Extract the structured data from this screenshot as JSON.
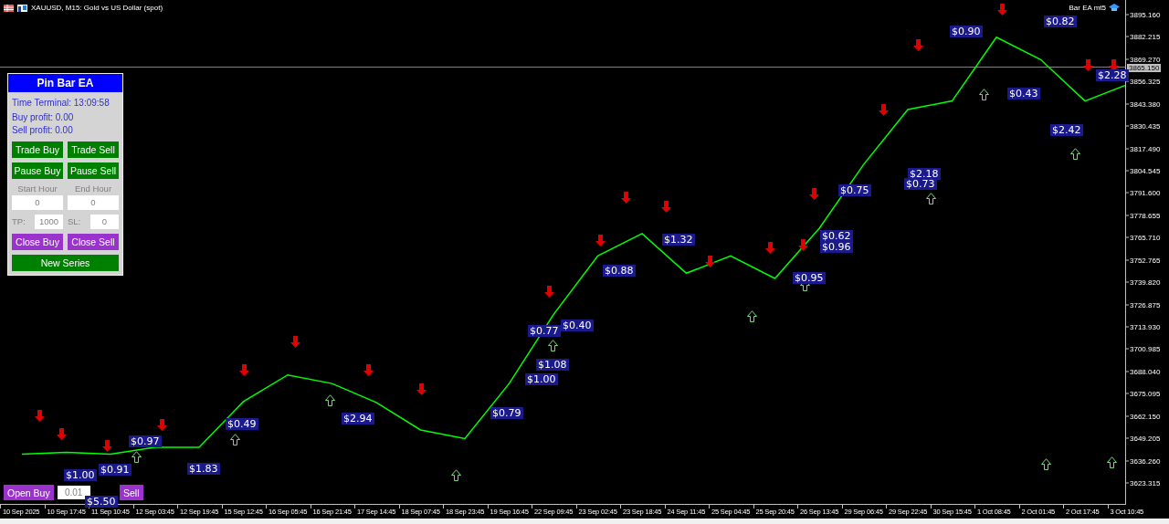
{
  "window": {
    "title": "XAUUSD, M15:  Gold vs US Dollar (spot)",
    "indicator": "Bar EA mt5"
  },
  "panel": {
    "title": "Pin Bar EA",
    "time": "Time Terminal: 13:09:58",
    "buy_profit": "Buy profit: 0.00",
    "sell_profit": "Sell profit: 0.00",
    "button_rows": [
      [
        {
          "label": "Trade Buy",
          "color": "#008000"
        },
        {
          "label": "Trade Sell",
          "color": "#008000"
        }
      ],
      [
        {
          "label": "Pause Buy",
          "color": "#008000"
        },
        {
          "label": "Pause Sell",
          "color": "#008000"
        }
      ]
    ],
    "hours": {
      "start_label": "Start Hour",
      "end_label": "End Hour",
      "start_value": "0",
      "end_value": "0"
    },
    "tp": {
      "label": "TP:",
      "value": "1000"
    },
    "sl": {
      "label": "SL:",
      "value": "0"
    },
    "close_buttons": [
      {
        "label": "Close Buy",
        "color": "#9933cc"
      },
      {
        "label": "Close Sell",
        "color": "#9933cc"
      }
    ],
    "new_series": {
      "label": "New Series",
      "color": "#008000"
    }
  },
  "order_bar": {
    "open_buy": "Open Buy",
    "lot": "0.01",
    "sell": "Sell"
  },
  "chart": {
    "current_price": "3865.150",
    "chart_data": {
      "type": "line",
      "categories": [
        "10 Sep 2025",
        "10 Sep 17:45",
        "11 Sep 10:45",
        "12 Sep 03:45",
        "12 Sep 19:45",
        "15 Sep 12:45",
        "16 Sep 05:45",
        "16 Sep 21:45",
        "17 Sep 14:45",
        "18 Sep 07:45",
        "18 Sep 23:45",
        "19 Sep 16:45",
        "22 Sep 09:45",
        "23 Sep 02:45",
        "23 Sep 18:45",
        "24 Sep 11:45",
        "25 Sep 04:45",
        "25 Sep 20:45",
        "26 Sep 13:45",
        "29 Sep 06:45",
        "29 Sep 22:45",
        "30 Sep 15:45",
        "1 Oct 08:45",
        "2 Oct 01:45",
        "2 Oct 17:45",
        "3 Oct 10:45"
      ],
      "series": [
        {
          "color": "#00ff00",
          "values": [
            3640,
            3641,
            3640,
            3644,
            3644,
            3670.5,
            3686,
            3681,
            3670,
            3654,
            3649,
            3681,
            3721,
            3755,
            3768,
            3745,
            3755,
            3742,
            3771,
            3808,
            3840,
            3845,
            3882,
            3869,
            3845,
            3855
          ]
        }
      ],
      "ylim": [
        3611.1,
        3903.6
      ],
      "yticks": [
        {
          "value": 3895.16,
          "label": "3895.160"
        },
        {
          "value": 3882.215,
          "label": "3882.215"
        },
        {
          "value": 3869.27,
          "label": "3869.270"
        },
        {
          "value": 3856.325,
          "label": "3856.325"
        },
        {
          "value": 3843.38,
          "label": "3843.380"
        },
        {
          "value": 3830.435,
          "label": "3830.435"
        },
        {
          "value": 3817.49,
          "label": "3817.490"
        },
        {
          "value": 3804.545,
          "label": "3804.545"
        },
        {
          "value": 3791.6,
          "label": "3791.600"
        },
        {
          "value": 3778.655,
          "label": "3778.655"
        },
        {
          "value": 3765.71,
          "label": "3765.710"
        },
        {
          "value": 3752.765,
          "label": "3752.765"
        },
        {
          "value": 3739.82,
          "label": "3739.820"
        },
        {
          "value": 3726.875,
          "label": "3726.875"
        },
        {
          "value": 3713.93,
          "label": "3713.930"
        },
        {
          "value": 3700.985,
          "label": "3700.985"
        },
        {
          "value": 3688.04,
          "label": "3688.040"
        },
        {
          "value": 3675.095,
          "label": "3675.095"
        },
        {
          "value": 3662.15,
          "label": "3662.150"
        },
        {
          "value": 3649.205,
          "label": "3649.205"
        },
        {
          "value": 3636.26,
          "label": "3636.260"
        },
        {
          "value": 3623.315,
          "label": "3623.315"
        }
      ]
    },
    "trade_labels": [
      "$0.49",
      "$0.97",
      "$1.00",
      "$5.50",
      "$0.91",
      "$1.83",
      "$2.94",
      "$0.79",
      "$1.08",
      "$1.00",
      "$0.77",
      "$0.40",
      "$0.88",
      "$1.32",
      "$0.95",
      "$0.62",
      "$0.96",
      "$0.75",
      "$2.18",
      "$0.73",
      "$0.43",
      "$0.90",
      "$0.82",
      "$2.42",
      "$2.28"
    ]
  }
}
